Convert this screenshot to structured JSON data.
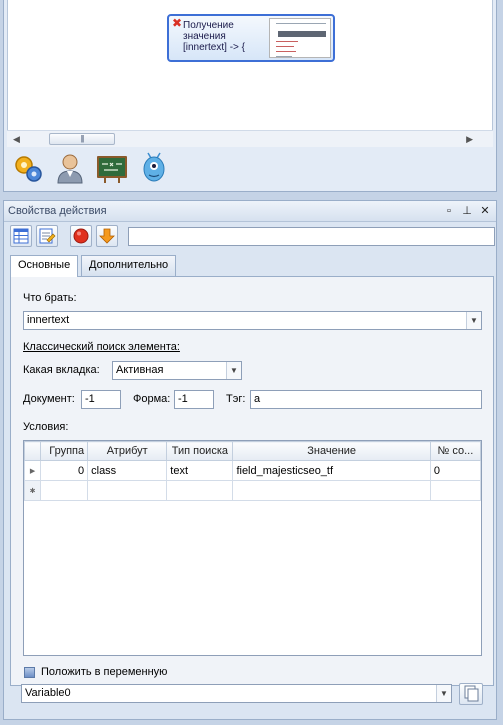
{
  "designer": {
    "node": {
      "error_icon": "close-red-icon",
      "lines": [
        "Получение",
        "значения",
        "[innertext] -> {"
      ],
      "thumb_caption": "Sans Mis Stant"
    },
    "scrollbar": {
      "left_arrow": "◀",
      "right_arrow": "▶",
      "grip": "|||"
    },
    "tools": [
      {
        "icon": "gears-icon"
      },
      {
        "icon": "user-icon"
      },
      {
        "icon": "chalkboard-icon"
      },
      {
        "icon": "alien-icon"
      }
    ]
  },
  "props": {
    "title": "Свойства действия",
    "header_buttons": {
      "restore": "▫",
      "pin": "⊥",
      "close": "✕"
    },
    "toolbar": {
      "buttons": [
        {
          "icon": "table-icon"
        },
        {
          "icon": "edit-icon"
        },
        {
          "icon": "stop-red-icon"
        },
        {
          "icon": "arrow-down-orange-icon"
        }
      ],
      "input_value": ""
    },
    "tabs": [
      "Основные",
      "Дополнительно"
    ],
    "what_label": "Что брать:",
    "what_value": "innertext",
    "classic_search_label": "Классический поиск элемента:",
    "tab_label": "Какая вкладка:",
    "tab_value": "Активная",
    "document_label": "Документ:",
    "document_value": "-1",
    "form_label": "Форма:",
    "form_value": "-1",
    "tag_label": "Тэг:",
    "tag_value": "a",
    "conditions_label": "Условия:",
    "grid": {
      "columns": [
        "Группа",
        "Атрибут",
        "Тип поиска",
        "Значение",
        "№ со..."
      ],
      "rows": [
        {
          "marker": "▶",
          "group": "0",
          "attribute": "class",
          "search_type": "text",
          "value": "field_majesticseo_tf",
          "number": "0"
        }
      ],
      "new_row_marker": "✱"
    },
    "save_var_label": "Положить в переменную",
    "variable_value": "Variable0",
    "dropdown_arrow": "▼"
  },
  "colors": {
    "accent": "#3d6fd6",
    "panel_bg": "#dbe5f2",
    "error": "#d93025"
  }
}
